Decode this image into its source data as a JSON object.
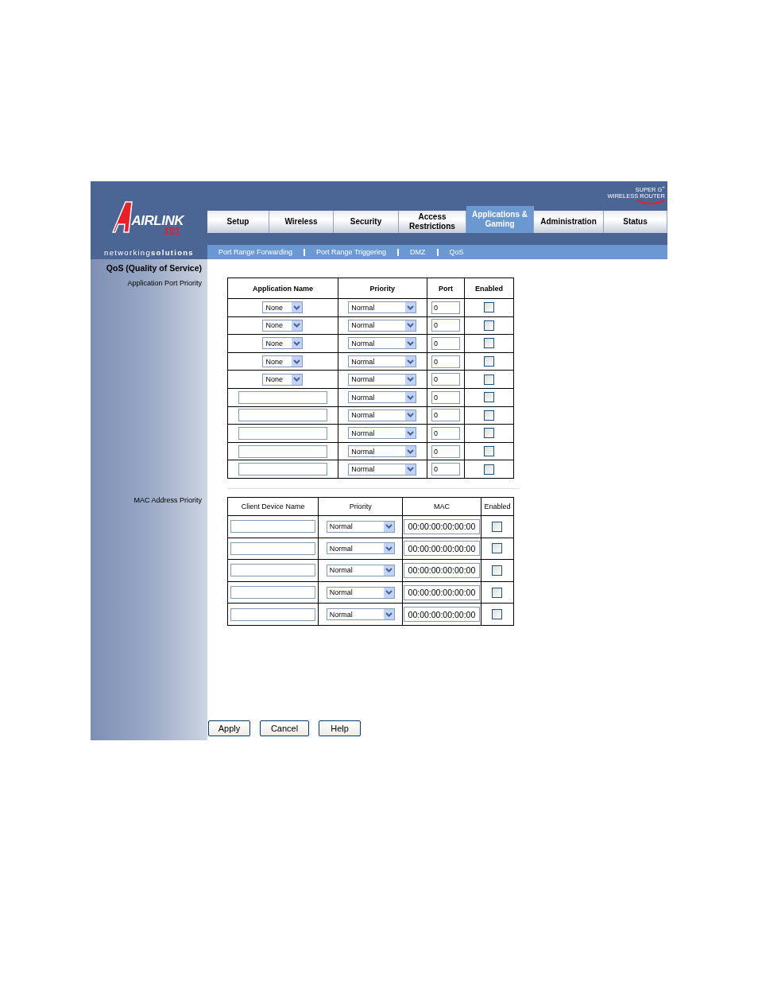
{
  "logo": {
    "wordmark": "AIRLINK",
    "number": "101",
    "tagline": "networking**solutions**"
  },
  "badge": {
    "line_1": "SUPER G$^{+}$",
    "line_2": "WIRELESS ROUTER"
  },
  "tabs": [
    {
      "label": "Setup",
      "selected": false
    },
    {
      "label": "Wireless",
      "selected": false
    },
    {
      "label": "Security",
      "selected": false
    },
    {
      "label": "Access Restrictions",
      "selected": false
    },
    {
      "label": "Applications & Gaming",
      "selected": true
    },
    {
      "label": "Administration",
      "selected": false
    },
    {
      "label": "Status",
      "selected": false
    }
  ],
  "subtabs": [
    "Port Range Forwarding",
    "Port Range Triggering",
    "DMZ",
    "QoS"
  ],
  "sidebar": {
    "title": "QoS (Quality of Service)",
    "sections": [
      "Application Port Priority",
      "MAC Address Priority"
    ]
  },
  "app_table": {
    "columns": [
      "Application Name",
      "Priority",
      "Port",
      "Enabled"
    ],
    "rows": [
      {
        "kind": "select",
        "application": "None",
        "priority": "Normal",
        "port": "0",
        "enabled": false
      },
      {
        "kind": "select",
        "application": "None",
        "priority": "Normal",
        "port": "0",
        "enabled": false
      },
      {
        "kind": "select",
        "application": "None",
        "priority": "Normal",
        "port": "0",
        "enabled": false
      },
      {
        "kind": "select",
        "application": "None",
        "priority": "Normal",
        "port": "0",
        "enabled": false
      },
      {
        "kind": "select",
        "application": "None",
        "priority": "Normal",
        "port": "0",
        "enabled": false
      },
      {
        "kind": "text",
        "priority": "Normal",
        "port": "0",
        "enabled": false
      },
      {
        "kind": "text",
        "priority": "Normal",
        "port": "0",
        "enabled": false
      },
      {
        "kind": "text",
        "priority": "Normal",
        "port": "0",
        "enabled": false
      },
      {
        "kind": "text",
        "priority": "Normal",
        "port": "0",
        "enabled": false
      },
      {
        "kind": "text",
        "priority": "Normal",
        "port": "0",
        "enabled": false
      }
    ]
  },
  "mac_table": {
    "columns": [
      "Client Device Name",
      "Priority",
      "MAC",
      "Enabled"
    ],
    "rows": [
      {
        "priority": "Normal",
        "mac": "00:00:00:00:00:00",
        "enabled": false
      },
      {
        "priority": "Normal",
        "mac": "00:00:00:00:00:00",
        "enabled": false
      },
      {
        "priority": "Normal",
        "mac": "00:00:00:00:00:00",
        "enabled": false
      },
      {
        "priority": "Normal",
        "mac": "00:00:00:00:00:00",
        "enabled": false
      },
      {
        "priority": "Normal",
        "mac": "00:00:00:00:00:00",
        "enabled": false
      }
    ]
  },
  "buttons": [
    "Apply",
    "Cancel",
    "Help"
  ]
}
